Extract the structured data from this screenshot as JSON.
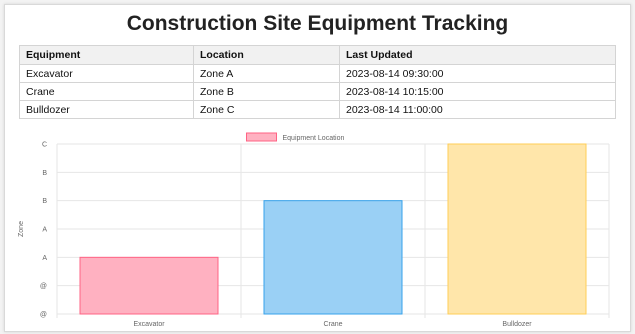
{
  "title": "Construction Site Equipment Tracking",
  "table": {
    "headers": [
      "Equipment",
      "Location",
      "Last Updated"
    ],
    "rows": [
      [
        "Excavator",
        "Zone A",
        "2023-08-14 09:30:00"
      ],
      [
        "Crane",
        "Zone B",
        "2023-08-14 10:15:00"
      ],
      [
        "Bulldozer",
        "Zone C",
        "2023-08-14 11:00:00"
      ]
    ]
  },
  "chart_data": {
    "type": "bar",
    "categories": [
      "Excavator",
      "Crane",
      "Bulldozer"
    ],
    "series": [
      {
        "name": "Equipment Location",
        "values": [
          2,
          4,
          6
        ]
      }
    ],
    "ylabel": "Zone",
    "ylim": [
      0,
      6
    ],
    "y_tick_labels": [
      "@",
      "@",
      "A",
      "A",
      "B",
      "B",
      "C"
    ],
    "legend_position": "top",
    "grid": true,
    "colors": {
      "fills": [
        "#ffb1c1",
        "#9ad0f5",
        "#ffe6aa"
      ],
      "strokes": [
        "#ff6384",
        "#36a2eb",
        "#ffcd56"
      ]
    }
  }
}
